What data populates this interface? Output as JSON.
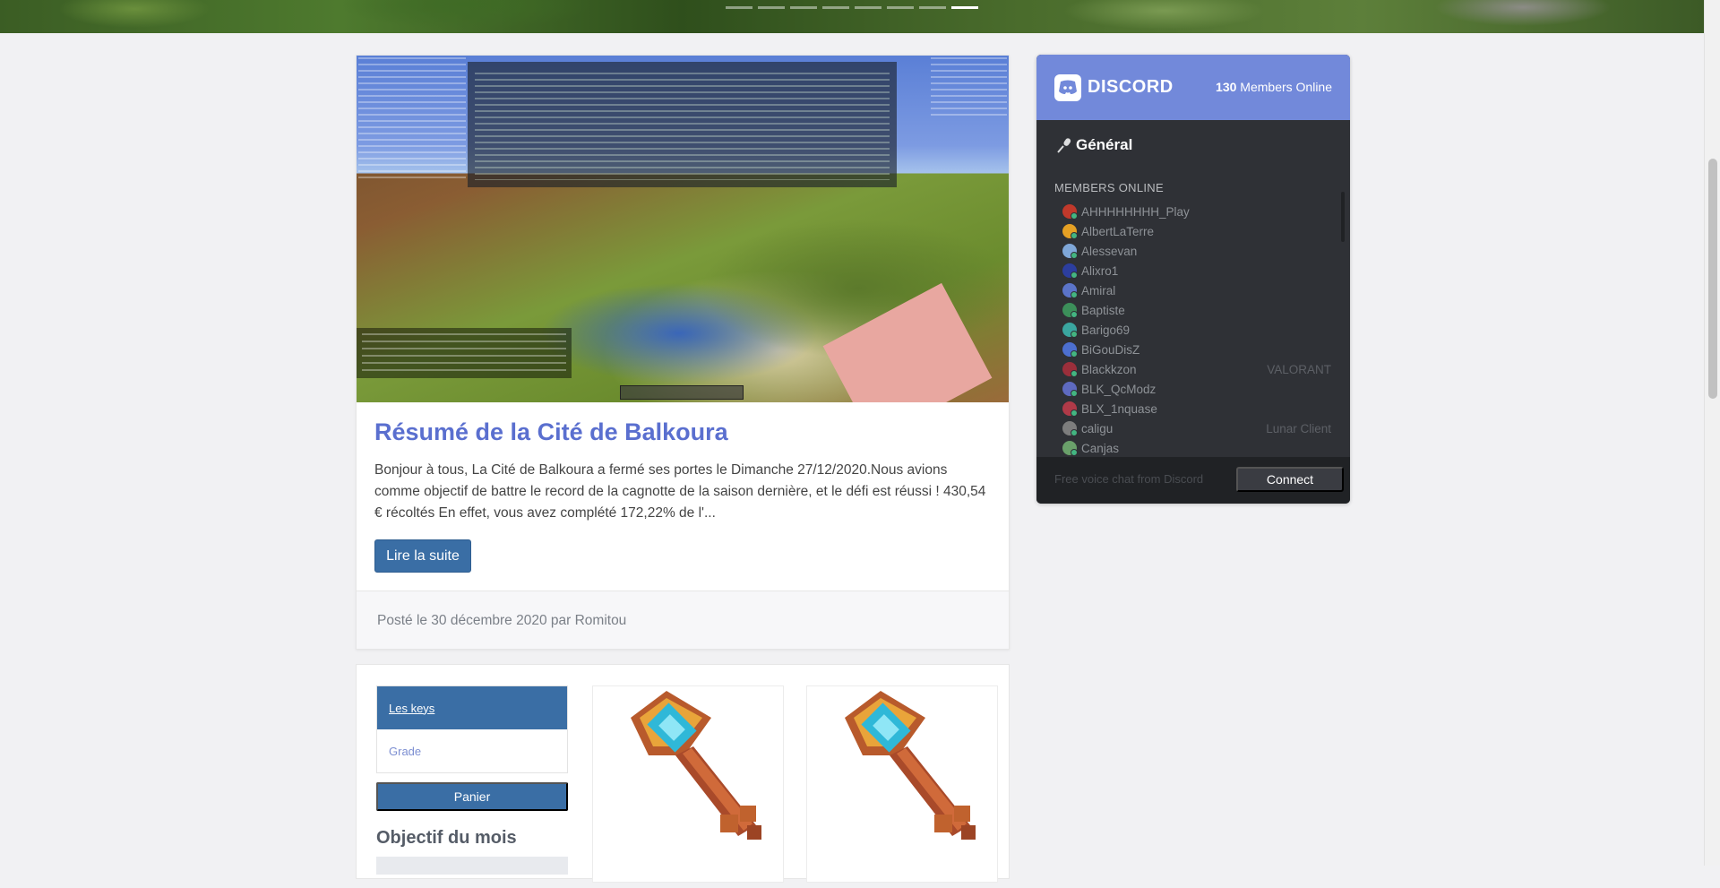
{
  "carousel": {
    "slide_count": 8,
    "active_index": 7
  },
  "post": {
    "title": "Résumé de la Cité de Balkoura",
    "excerpt": "Bonjour à tous, La Cité de Balkoura a fermé ses portes le Dimanche 27/12/2020.Nous avions comme objectif de battre le record de la cagnotte de la saison dernière, et le défi est réussi ! 430,54 € récoltés En effet, vous avez complété 172,22% de l'...",
    "read_more_label": "Lire la suite",
    "meta": "Posté le 30 décembre 2020 par Romitou"
  },
  "shop": {
    "nav": [
      {
        "label": "Les keys",
        "active": true
      },
      {
        "label": "Grade",
        "active": false
      }
    ],
    "cart_label": "Panier",
    "objective_title": "Objectif du mois",
    "products": [
      {
        "icon": "key-icon"
      },
      {
        "icon": "key-icon"
      }
    ]
  },
  "discord": {
    "brand": "DISCORD",
    "online_count": "130",
    "online_suffix": "Members Online",
    "channel": "Général",
    "channel_icon": "microphone-icon",
    "members_label": "MEMBERS ONLINE",
    "members": [
      {
        "name": "AHHHHHHHH_Play",
        "game": "",
        "color": "#c0392b"
      },
      {
        "name": "AlbertLaTerre",
        "game": "",
        "color": "#e5a024"
      },
      {
        "name": "Alessevan",
        "game": "",
        "color": "#7fa7d8"
      },
      {
        "name": "Alixro1",
        "game": "",
        "color": "#2c3e9e"
      },
      {
        "name": "Amiral",
        "game": "",
        "color": "#5b74c9"
      },
      {
        "name": "Baptiste",
        "game": "",
        "color": "#3c8f5a"
      },
      {
        "name": "Barigo69",
        "game": "",
        "color": "#3aa6a0"
      },
      {
        "name": "BiGouDisZ",
        "game": "",
        "color": "#4c6fd0"
      },
      {
        "name": "Blackkzon",
        "game": "VALORANT",
        "color": "#9b2f3b"
      },
      {
        "name": "BLK_QcModz",
        "game": "",
        "color": "#5e6ac0"
      },
      {
        "name": "BLX_1nquase",
        "game": "",
        "color": "#b03a48"
      },
      {
        "name": "caligu",
        "game": "Lunar Client",
        "color": "#7d7d7d"
      },
      {
        "name": "Canjas",
        "game": "",
        "color": "#6aa06a"
      }
    ],
    "footer_text": "Free voice chat from Discord",
    "connect_label": "Connect",
    "brand_color": "#7289da"
  }
}
